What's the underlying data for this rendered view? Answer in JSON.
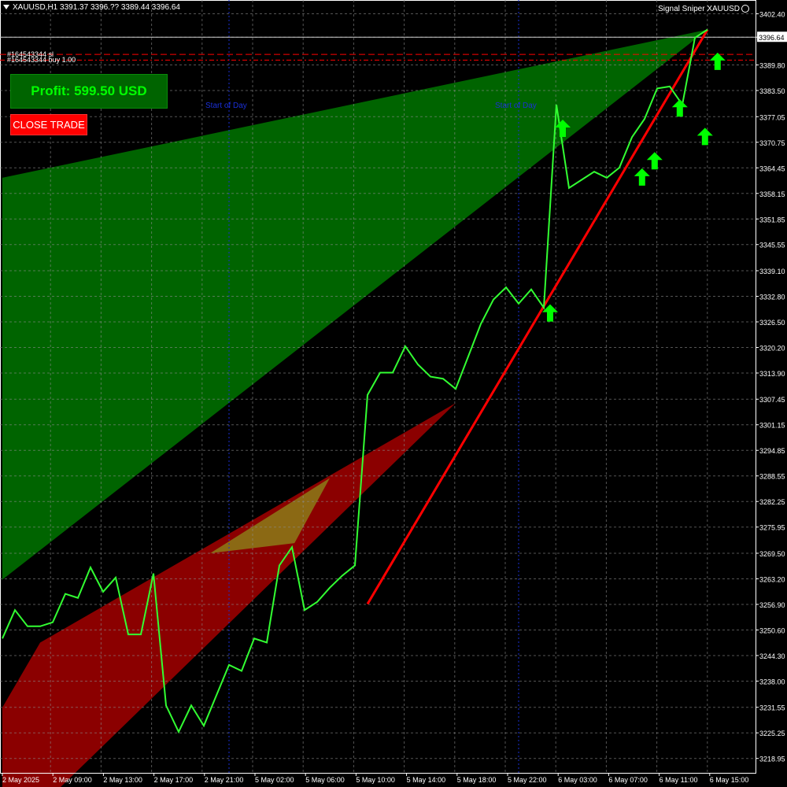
{
  "header": {
    "symbol_text": "XAUUSD,H1  3391.37 3396.?? 3389.44 3396.64",
    "indicator_name": "Signal Sniper XAUUSD"
  },
  "orders": [
    {
      "label": "#164543344 sl"
    },
    {
      "label": "#164543344 buy 1.00"
    }
  ],
  "panel": {
    "profit_label": "Profit: 599.50 USD",
    "close_button_label": "CLOSE TRADE"
  },
  "markers": {
    "start_of_day_label": "Start of Day"
  },
  "colors": {
    "background": "#000000",
    "grid": "#8c8c8c",
    "price_line": "#32ff32",
    "trend_line": "#ff0000",
    "upper_zone": "#006400",
    "lower_zone": "#8b0000",
    "overlap_zone": "#8b6914",
    "signal_arrow": "#00ff00",
    "start_of_day_line": "#1a2fd6"
  },
  "chart_data": {
    "type": "line",
    "title": "",
    "symbol": "XAUUSD",
    "timeframe": "H1",
    "grid": true,
    "ylim": [
      3215.4,
      3405.8
    ],
    "y_ticks": [
      "3402.40",
      "3396.64",
      "3389.80",
      "3383.50",
      "3377.05",
      "3370.75",
      "3364.45",
      "3358.15",
      "3351.85",
      "3345.55",
      "3339.10",
      "3332.80",
      "3326.50",
      "3320.20",
      "3313.90",
      "3307.45",
      "3301.15",
      "3294.85",
      "3288.55",
      "3282.25",
      "3275.95",
      "3269.50",
      "3263.20",
      "3256.90",
      "3250.60",
      "3244.30",
      "3238.00",
      "3231.55",
      "3225.25",
      "3218.95"
    ],
    "current_price": "3396.64",
    "x_labels": [
      "2 May 2025",
      "2 May 09:00",
      "2 May 13:00",
      "2 May 17:00",
      "2 May 21:00",
      "5 May 02:00",
      "5 May 06:00",
      "5 May 10:00",
      "5 May 14:00",
      "5 May 18:00",
      "5 May 22:00",
      "6 May 03:00",
      "6 May 07:00",
      "6 May 11:00",
      "6 May 15:00"
    ],
    "series": [
      {
        "type": "line",
        "x": [
          0,
          1,
          2,
          3,
          4,
          5,
          6,
          7,
          8,
          9,
          10,
          11,
          12,
          13,
          14,
          15,
          16,
          17,
          18,
          19,
          20,
          21,
          22,
          23,
          24,
          25,
          26,
          27,
          28,
          29,
          30,
          31,
          32,
          33,
          34,
          35,
          36,
          37,
          38,
          39,
          40,
          41,
          42,
          43,
          44,
          45,
          46,
          47,
          48,
          49,
          50,
          51,
          52,
          53,
          54,
          55,
          56
        ],
        "values": [
          3248.5,
          3255.5,
          3251.5,
          3251.5,
          3252.5,
          3259.5,
          3258.5,
          3266.0,
          3260.0,
          3263.5,
          3249.5,
          3249.5,
          3264.5,
          3232.0,
          3225.5,
          3232.0,
          3227.0,
          3234.5,
          3242.0,
          3240.5,
          3248.5,
          3247.5,
          3266.5,
          3271.0,
          3255.5,
          3257.5,
          3261.0,
          3264.0,
          3266.5,
          3308.5,
          3314.0,
          3314.0,
          3320.5,
          3316.0,
          3313.0,
          3312.5,
          3310.0,
          3318.0,
          3326.0,
          3332.0,
          3335.0,
          3331.0,
          3334.5,
          3330.0,
          3380.0,
          3359.5,
          3361.5,
          3363.5,
          3362.0,
          3364.5,
          3372.0,
          3376.5,
          3384.0,
          3384.5,
          3380.0,
          3396.5,
          3398.5
        ]
      }
    ],
    "trend_line": {
      "x": [
        29,
        56
      ],
      "values": [
        3257.0,
        3398.5
      ]
    },
    "zones": [
      {
        "type": "upper",
        "x": [
          0,
          56
        ],
        "upper": [
          3362.0,
          3398.5
        ],
        "lower": [
          3263.0,
          3398.5
        ]
      },
      {
        "type": "lower",
        "x": [
          0,
          3,
          36
        ],
        "upper": [
          3231.5,
          3247.5,
          3306.5
        ],
        "lower": [
          3207.0,
          3207.0,
          3306.5
        ]
      }
    ],
    "buy_signals": [
      {
        "x": 44.5,
        "value": 3374.0
      },
      {
        "x": 43.5,
        "value": 3328.5
      },
      {
        "x": 50.8,
        "value": 3362.0
      },
      {
        "x": 51.8,
        "value": 3366.0
      },
      {
        "x": 53.8,
        "value": 3379.0
      },
      {
        "x": 55.8,
        "value": 3372.0
      },
      {
        "x": 56.8,
        "value": 3390.5
      }
    ],
    "start_of_day_x": [
      18,
      41
    ],
    "order_lines": [
      3391.0,
      3392.4
    ]
  }
}
